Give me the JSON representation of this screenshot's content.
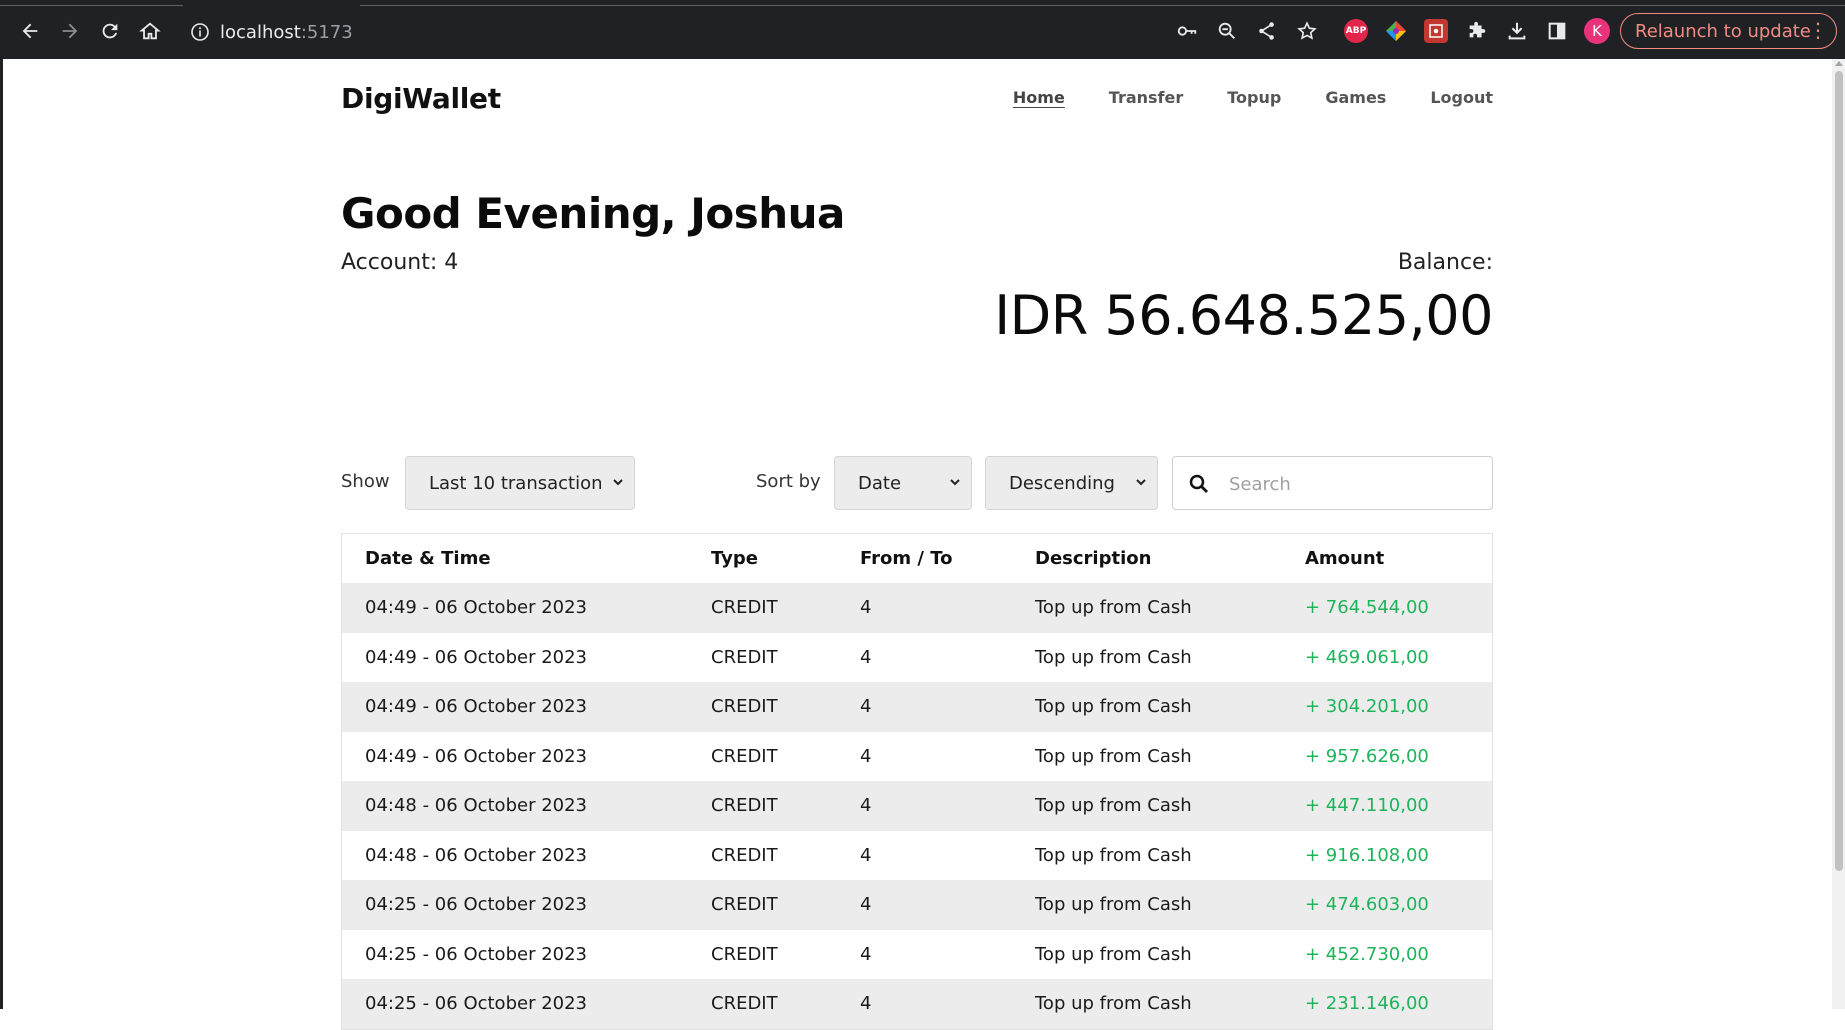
{
  "browser": {
    "url_host": "localhost",
    "url_port": ":5173",
    "profile_initial": "K",
    "relaunch_label": "Relaunch to update",
    "extensions": [
      "abp-icon",
      "color-picker-icon",
      "screenshot-icon",
      "puzzle-icon"
    ],
    "abp_label": "ABP"
  },
  "app": {
    "brand": "DigiWallet",
    "nav": [
      {
        "label": "Home",
        "active": true
      },
      {
        "label": "Transfer",
        "active": false
      },
      {
        "label": "Topup",
        "active": false
      },
      {
        "label": "Games",
        "active": false
      },
      {
        "label": "Logout",
        "active": false
      }
    ]
  },
  "dashboard": {
    "greeting": "Good Evening, Joshua",
    "account_label": "Account: 4",
    "balance_label": "Balance:",
    "balance_amount": "IDR 56.648.525,00"
  },
  "controls": {
    "show_label": "Show",
    "show_value": "Last 10 transaction",
    "sort_label": "Sort by",
    "sort_field": "Date",
    "sort_order": "Descending",
    "search_placeholder": "Search"
  },
  "table": {
    "columns": [
      "Date & Time",
      "Type",
      "From / To",
      "Description",
      "Amount"
    ],
    "rows": [
      [
        "04:49 - 06 October 2023",
        "CREDIT",
        "4",
        "Top up from Cash",
        "+ 764.544,00"
      ],
      [
        "04:49 - 06 October 2023",
        "CREDIT",
        "4",
        "Top up from Cash",
        "+ 469.061,00"
      ],
      [
        "04:49 - 06 October 2023",
        "CREDIT",
        "4",
        "Top up from Cash",
        "+ 304.201,00"
      ],
      [
        "04:49 - 06 October 2023",
        "CREDIT",
        "4",
        "Top up from Cash",
        "+ 957.626,00"
      ],
      [
        "04:48 - 06 October 2023",
        "CREDIT",
        "4",
        "Top up from Cash",
        "+ 447.110,00"
      ],
      [
        "04:48 - 06 October 2023",
        "CREDIT",
        "4",
        "Top up from Cash",
        "+ 916.108,00"
      ],
      [
        "04:25 - 06 October 2023",
        "CREDIT",
        "4",
        "Top up from Cash",
        "+ 474.603,00"
      ],
      [
        "04:25 - 06 October 2023",
        "CREDIT",
        "4",
        "Top up from Cash",
        "+ 452.730,00"
      ],
      [
        "04:25 - 06 October 2023",
        "CREDIT",
        "4",
        "Top up from Cash",
        "+ 231.146,00"
      ]
    ]
  },
  "colors": {
    "credit_amount": "#1fb35a",
    "stripe": "#ececec",
    "chrome_bg": "#202124",
    "relaunch": "#f28b82"
  }
}
